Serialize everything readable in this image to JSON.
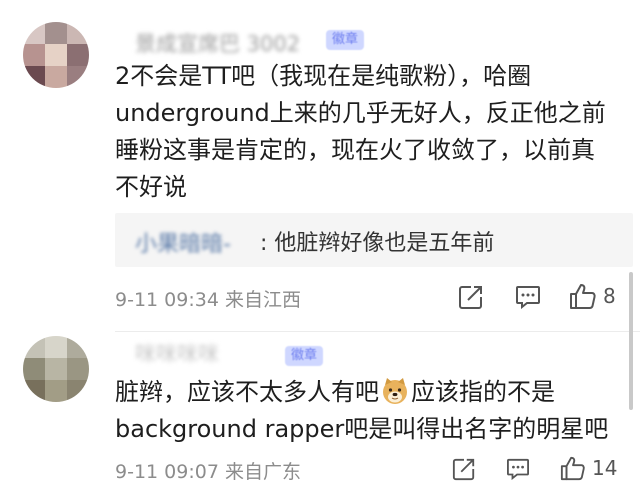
{
  "comments": [
    {
      "username": "景成宣席巴 3002",
      "badge": "徽章",
      "lines": [
        "2不会是TT吧（我现在是纯歌粉），哈圈",
        "underground上来的几乎无好人，反正他之前",
        "睡粉这事是肯定的，现在火了收敛了，以前真",
        "不好说"
      ],
      "reply": {
        "author": "小果暗暗-",
        "text": ": 他脏辫好像也是五年前"
      },
      "meta": "9-11 09:34  来自江西",
      "likes": "8"
    },
    {
      "username": "咪咪咪咪",
      "badge": "徽章",
      "line1_before": "脏辫，应该不太多人有吧",
      "line1_after": "应该指的不是",
      "line2": "background rapper吧是叫得出名字的明星吧",
      "meta": "9-11 09:07  来自广东",
      "likes": "14"
    }
  ],
  "icons": {
    "share": "share-icon",
    "comment": "comment-icon",
    "like": "thumbs-up-icon",
    "emoji": "doge-emoji-icon"
  },
  "colors": {
    "meta_gray": "#8c8c8c",
    "reply_bg": "#f5f5f5",
    "name_blue": "#5a7aa8",
    "badge_bg": "#cfd7ff"
  }
}
